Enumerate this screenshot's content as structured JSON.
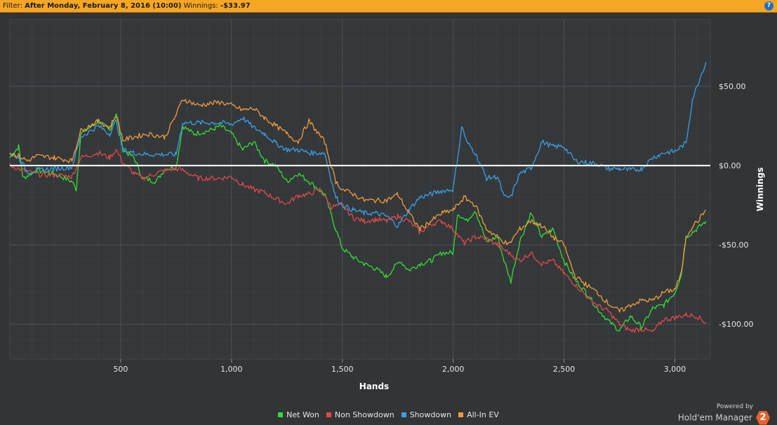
{
  "filter_bar": {
    "prefix": "Filter: ",
    "filter": "After Monday, February 8, 2016 (10:00)",
    "winnings_label": "Winnings: ",
    "winnings_value": "-$33.97",
    "help_icon": "help-icon",
    "help_glyph": "?"
  },
  "chart_data": {
    "type": "line",
    "xlabel": "Hands",
    "ylabel": "Winnings",
    "xlim": [
      0,
      3160
    ],
    "ylim": [
      -122,
      92
    ],
    "x_ticks": [
      500,
      1000,
      1500,
      2000,
      2500,
      3000
    ],
    "x_tick_labels": [
      "500",
      "1,000",
      "1,500",
      "2,000",
      "2,500",
      "3,000"
    ],
    "y_ticks": [
      50,
      0,
      -50,
      -100
    ],
    "y_tick_labels": [
      "$50.00",
      "$0.00",
      "-$50.00",
      "-$100.00"
    ],
    "grid": true,
    "legend_position": "bottom",
    "zero_line_color": "#ffffff",
    "series": [
      {
        "name": "Net Won",
        "color": "#33dd33",
        "points": [
          [
            0,
            5
          ],
          [
            40,
            12
          ],
          [
            60,
            -8
          ],
          [
            120,
            -3
          ],
          [
            200,
            -5
          ],
          [
            280,
            -10
          ],
          [
            300,
            -15
          ],
          [
            320,
            20
          ],
          [
            400,
            28
          ],
          [
            450,
            22
          ],
          [
            480,
            33
          ],
          [
            510,
            10
          ],
          [
            560,
            5
          ],
          [
            600,
            -8
          ],
          [
            660,
            -10
          ],
          [
            700,
            -2
          ],
          [
            750,
            -1
          ],
          [
            780,
            25
          ],
          [
            830,
            20
          ],
          [
            900,
            22
          ],
          [
            950,
            25
          ],
          [
            1000,
            20
          ],
          [
            1050,
            10
          ],
          [
            1100,
            15
          ],
          [
            1150,
            3
          ],
          [
            1200,
            0
          ],
          [
            1250,
            -10
          ],
          [
            1300,
            -5
          ],
          [
            1350,
            -10
          ],
          [
            1420,
            -18
          ],
          [
            1470,
            -40
          ],
          [
            1500,
            -52
          ],
          [
            1550,
            -58
          ],
          [
            1600,
            -62
          ],
          [
            1650,
            -65
          ],
          [
            1700,
            -70
          ],
          [
            1760,
            -60
          ],
          [
            1800,
            -66
          ],
          [
            1850,
            -62
          ],
          [
            1900,
            -60
          ],
          [
            1950,
            -55
          ],
          [
            2000,
            -55
          ],
          [
            2020,
            -30
          ],
          [
            2060,
            -35
          ],
          [
            2100,
            -28
          ],
          [
            2150,
            -48
          ],
          [
            2200,
            -45
          ],
          [
            2230,
            -60
          ],
          [
            2260,
            -73
          ],
          [
            2300,
            -48
          ],
          [
            2350,
            -30
          ],
          [
            2400,
            -45
          ],
          [
            2450,
            -40
          ],
          [
            2500,
            -60
          ],
          [
            2550,
            -72
          ],
          [
            2600,
            -80
          ],
          [
            2650,
            -90
          ],
          [
            2700,
            -98
          ],
          [
            2750,
            -104
          ],
          [
            2800,
            -95
          ],
          [
            2850,
            -102
          ],
          [
            2900,
            -90
          ],
          [
            2950,
            -88
          ],
          [
            3000,
            -80
          ],
          [
            3030,
            -68
          ],
          [
            3050,
            -45
          ],
          [
            3100,
            -40
          ],
          [
            3140,
            -35
          ]
        ]
      },
      {
        "name": "Non Showdown",
        "color": "#e04848",
        "points": [
          [
            0,
            0
          ],
          [
            40,
            -2
          ],
          [
            80,
            -4
          ],
          [
            150,
            -6
          ],
          [
            200,
            -6
          ],
          [
            280,
            -7
          ],
          [
            320,
            5
          ],
          [
            400,
            8
          ],
          [
            450,
            5
          ],
          [
            480,
            10
          ],
          [
            510,
            2
          ],
          [
            560,
            -5
          ],
          [
            600,
            -8
          ],
          [
            660,
            -5
          ],
          [
            700,
            -3
          ],
          [
            750,
            -2
          ],
          [
            780,
            -3
          ],
          [
            850,
            -8
          ],
          [
            950,
            -8
          ],
          [
            1000,
            -7
          ],
          [
            1050,
            -12
          ],
          [
            1100,
            -15
          ],
          [
            1150,
            -17
          ],
          [
            1200,
            -21
          ],
          [
            1250,
            -24
          ],
          [
            1300,
            -19
          ],
          [
            1350,
            -18
          ],
          [
            1400,
            -15
          ],
          [
            1450,
            -26
          ],
          [
            1500,
            -25
          ],
          [
            1550,
            -33
          ],
          [
            1600,
            -35
          ],
          [
            1650,
            -34
          ],
          [
            1700,
            -35
          ],
          [
            1750,
            -32
          ],
          [
            1800,
            -35
          ],
          [
            1850,
            -42
          ],
          [
            1900,
            -37
          ],
          [
            1950,
            -35
          ],
          [
            2000,
            -40
          ],
          [
            2050,
            -49
          ],
          [
            2100,
            -45
          ],
          [
            2150,
            -46
          ],
          [
            2200,
            -50
          ],
          [
            2250,
            -55
          ],
          [
            2300,
            -60
          ],
          [
            2350,
            -55
          ],
          [
            2400,
            -62
          ],
          [
            2450,
            -60
          ],
          [
            2500,
            -68
          ],
          [
            2550,
            -75
          ],
          [
            2600,
            -82
          ],
          [
            2650,
            -88
          ],
          [
            2700,
            -92
          ],
          [
            2750,
            -100
          ],
          [
            2800,
            -104
          ],
          [
            2850,
            -103
          ],
          [
            2900,
            -105
          ],
          [
            2950,
            -97
          ],
          [
            3000,
            -96
          ],
          [
            3050,
            -94
          ],
          [
            3100,
            -95
          ],
          [
            3140,
            -99
          ]
        ]
      },
      {
        "name": "Showdown",
        "color": "#3a9fe4",
        "points": [
          [
            0,
            8
          ],
          [
            40,
            5
          ],
          [
            80,
            -4
          ],
          [
            120,
            -3
          ],
          [
            200,
            -2
          ],
          [
            280,
            -1
          ],
          [
            320,
            18
          ],
          [
            400,
            25
          ],
          [
            450,
            20
          ],
          [
            480,
            28
          ],
          [
            510,
            10
          ],
          [
            560,
            8
          ],
          [
            620,
            7
          ],
          [
            700,
            7
          ],
          [
            750,
            7
          ],
          [
            780,
            27
          ],
          [
            850,
            27
          ],
          [
            950,
            27
          ],
          [
            1000,
            26
          ],
          [
            1050,
            30
          ],
          [
            1100,
            24
          ],
          [
            1150,
            20
          ],
          [
            1200,
            14
          ],
          [
            1250,
            10
          ],
          [
            1300,
            10
          ],
          [
            1350,
            8
          ],
          [
            1420,
            8
          ],
          [
            1470,
            -20
          ],
          [
            1500,
            -25
          ],
          [
            1550,
            -28
          ],
          [
            1600,
            -30
          ],
          [
            1650,
            -30
          ],
          [
            1700,
            -32
          ],
          [
            1750,
            -38
          ],
          [
            1800,
            -28
          ],
          [
            1850,
            -20
          ],
          [
            1900,
            -18
          ],
          [
            1950,
            -16
          ],
          [
            2000,
            -15
          ],
          [
            2020,
            5
          ],
          [
            2040,
            25
          ],
          [
            2060,
            15
          ],
          [
            2100,
            8
          ],
          [
            2150,
            -8
          ],
          [
            2200,
            -7
          ],
          [
            2230,
            -20
          ],
          [
            2260,
            -20
          ],
          [
            2300,
            -5
          ],
          [
            2350,
            -2
          ],
          [
            2400,
            15
          ],
          [
            2450,
            12
          ],
          [
            2500,
            12
          ],
          [
            2550,
            3
          ],
          [
            2600,
            2
          ],
          [
            2650,
            1
          ],
          [
            2700,
            -2
          ],
          [
            2750,
            -2
          ],
          [
            2800,
            -3
          ],
          [
            2850,
            -2
          ],
          [
            2900,
            5
          ],
          [
            2950,
            8
          ],
          [
            3000,
            9
          ],
          [
            3050,
            14
          ],
          [
            3080,
            42
          ],
          [
            3110,
            54
          ],
          [
            3140,
            65
          ]
        ]
      },
      {
        "name": "All-In EV",
        "color": "#f29a3c",
        "points": [
          [
            0,
            8
          ],
          [
            40,
            6
          ],
          [
            80,
            3
          ],
          [
            120,
            6
          ],
          [
            200,
            5
          ],
          [
            280,
            3
          ],
          [
            320,
            22
          ],
          [
            400,
            28
          ],
          [
            450,
            24
          ],
          [
            480,
            32
          ],
          [
            510,
            16
          ],
          [
            560,
            18
          ],
          [
            620,
            20
          ],
          [
            700,
            18
          ],
          [
            750,
            32
          ],
          [
            780,
            42
          ],
          [
            850,
            38
          ],
          [
            950,
            40
          ],
          [
            1000,
            38
          ],
          [
            1050,
            35
          ],
          [
            1100,
            36
          ],
          [
            1150,
            30
          ],
          [
            1200,
            25
          ],
          [
            1250,
            20
          ],
          [
            1300,
            15
          ],
          [
            1350,
            28
          ],
          [
            1420,
            15
          ],
          [
            1470,
            -10
          ],
          [
            1500,
            -15
          ],
          [
            1550,
            -18
          ],
          [
            1600,
            -22
          ],
          [
            1650,
            -22
          ],
          [
            1700,
            -22
          ],
          [
            1750,
            -18
          ],
          [
            1800,
            -30
          ],
          [
            1850,
            -40
          ],
          [
            1900,
            -35
          ],
          [
            1950,
            -30
          ],
          [
            2000,
            -28
          ],
          [
            2050,
            -20
          ],
          [
            2100,
            -25
          ],
          [
            2150,
            -40
          ],
          [
            2200,
            -45
          ],
          [
            2250,
            -50
          ],
          [
            2300,
            -40
          ],
          [
            2350,
            -35
          ],
          [
            2400,
            -38
          ],
          [
            2450,
            -45
          ],
          [
            2500,
            -50
          ],
          [
            2550,
            -70
          ],
          [
            2600,
            -75
          ],
          [
            2650,
            -80
          ],
          [
            2700,
            -87
          ],
          [
            2750,
            -92
          ],
          [
            2800,
            -88
          ],
          [
            2850,
            -85
          ],
          [
            2900,
            -85
          ],
          [
            2950,
            -80
          ],
          [
            3000,
            -78
          ],
          [
            3030,
            -68
          ],
          [
            3050,
            -45
          ],
          [
            3080,
            -38
          ],
          [
            3110,
            -34
          ],
          [
            3140,
            -28
          ]
        ]
      }
    ]
  }
}
